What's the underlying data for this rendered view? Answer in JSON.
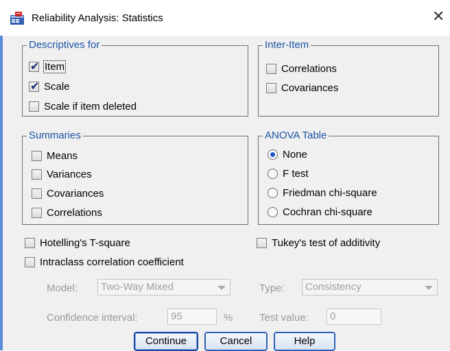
{
  "window": {
    "title": "Reliability Analysis: Statistics",
    "close_glyph": "✕",
    "icon": "spss-dialog-icon"
  },
  "descriptives": {
    "legend": "Descriptives for",
    "items": [
      {
        "label": "Item",
        "checked": true
      },
      {
        "label": "Scale",
        "checked": true
      },
      {
        "label": "Scale if item deleted",
        "checked": false
      }
    ]
  },
  "inter_item": {
    "legend": "Inter-Item",
    "items": [
      {
        "label": "Correlations",
        "checked": false
      },
      {
        "label": "Covariances",
        "checked": false
      }
    ]
  },
  "summaries": {
    "legend": "Summaries",
    "items": [
      {
        "label": "Means",
        "checked": false
      },
      {
        "label": "Variances",
        "checked": false
      },
      {
        "label": "Covariances",
        "checked": false
      },
      {
        "label": "Correlations",
        "checked": false
      }
    ]
  },
  "anova": {
    "legend": "ANOVA Table",
    "options": [
      {
        "label": "None",
        "selected": true
      },
      {
        "label": "F test",
        "selected": false
      },
      {
        "label": "Friedman chi-square",
        "selected": false
      },
      {
        "label": "Cochran chi-square",
        "selected": false
      }
    ]
  },
  "extra": {
    "hotelling": {
      "label": "Hotelling's T-square",
      "checked": false
    },
    "tukey": {
      "label": "Tukey's test of additivity",
      "checked": false
    },
    "intraclass": {
      "label": "Intraclass correlation coefficient",
      "checked": false
    }
  },
  "icc": {
    "model_label": "Model:",
    "model_value": "Two-Way Mixed",
    "type_label": "Type:",
    "type_value": "Consistency",
    "ci_label": "Confidence interval:",
    "ci_value": "95",
    "ci_unit": "%",
    "test_label": "Test value:",
    "test_value": "0"
  },
  "buttons": {
    "continue": "Continue",
    "cancel": "Cancel",
    "help": "Help"
  },
  "colors": {
    "legend": "#1a52a6",
    "button_border": "#2d5fb8",
    "disabled_text": "#9a9a9a"
  }
}
